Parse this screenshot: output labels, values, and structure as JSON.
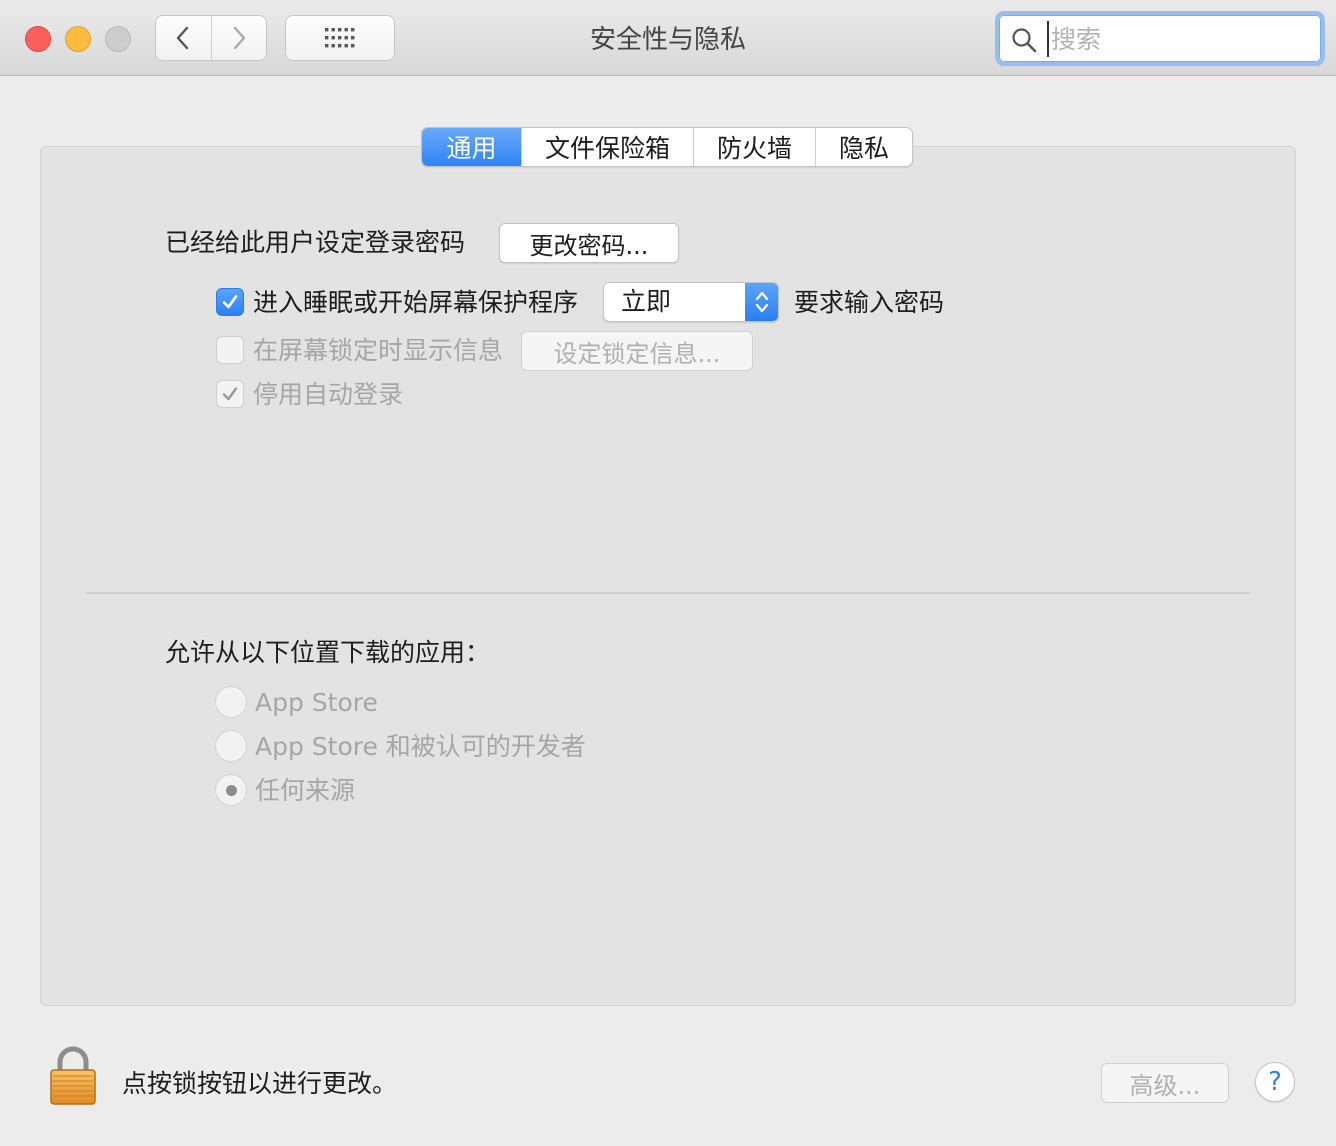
{
  "window": {
    "title": "安全性与隐私"
  },
  "toolbar": {
    "back_icon": "chevron-left-icon",
    "forward_icon": "chevron-right-icon",
    "show_all_icon": "grid-icon"
  },
  "search": {
    "placeholder": "搜索",
    "value": ""
  },
  "tabs": [
    {
      "label": "通用",
      "active": true
    },
    {
      "label": "文件保险箱",
      "active": false
    },
    {
      "label": "防火墙",
      "active": false
    },
    {
      "label": "隐私",
      "active": false
    }
  ],
  "general": {
    "password_set_label": "已经给此用户设定登录密码",
    "change_password_button": "更改密码...",
    "require_password": {
      "checked": true,
      "label": "进入睡眠或开始屏幕保护程序",
      "delay_value": "立即",
      "suffix_label": "要求输入密码"
    },
    "show_message": {
      "checked": false,
      "label": "在屏幕锁定时显示信息",
      "button": "设定锁定信息..."
    },
    "disable_auto_login": {
      "checked": true,
      "label": "停用自动登录"
    }
  },
  "downloads": {
    "heading": "允许从以下位置下载的应用：",
    "options": [
      {
        "label": "App Store",
        "selected": false
      },
      {
        "label": "App Store 和被认可的开发者",
        "selected": false
      },
      {
        "label": "任何来源",
        "selected": true
      }
    ]
  },
  "footer": {
    "lock_text": "点按锁按钮以进行更改。",
    "advanced_button": "高级...",
    "help_label": "?"
  },
  "colors": {
    "accent": "#2f84f4",
    "close": "#fc605c",
    "minimize": "#fdbc40",
    "zoom_disabled": "#cdcdcd"
  }
}
